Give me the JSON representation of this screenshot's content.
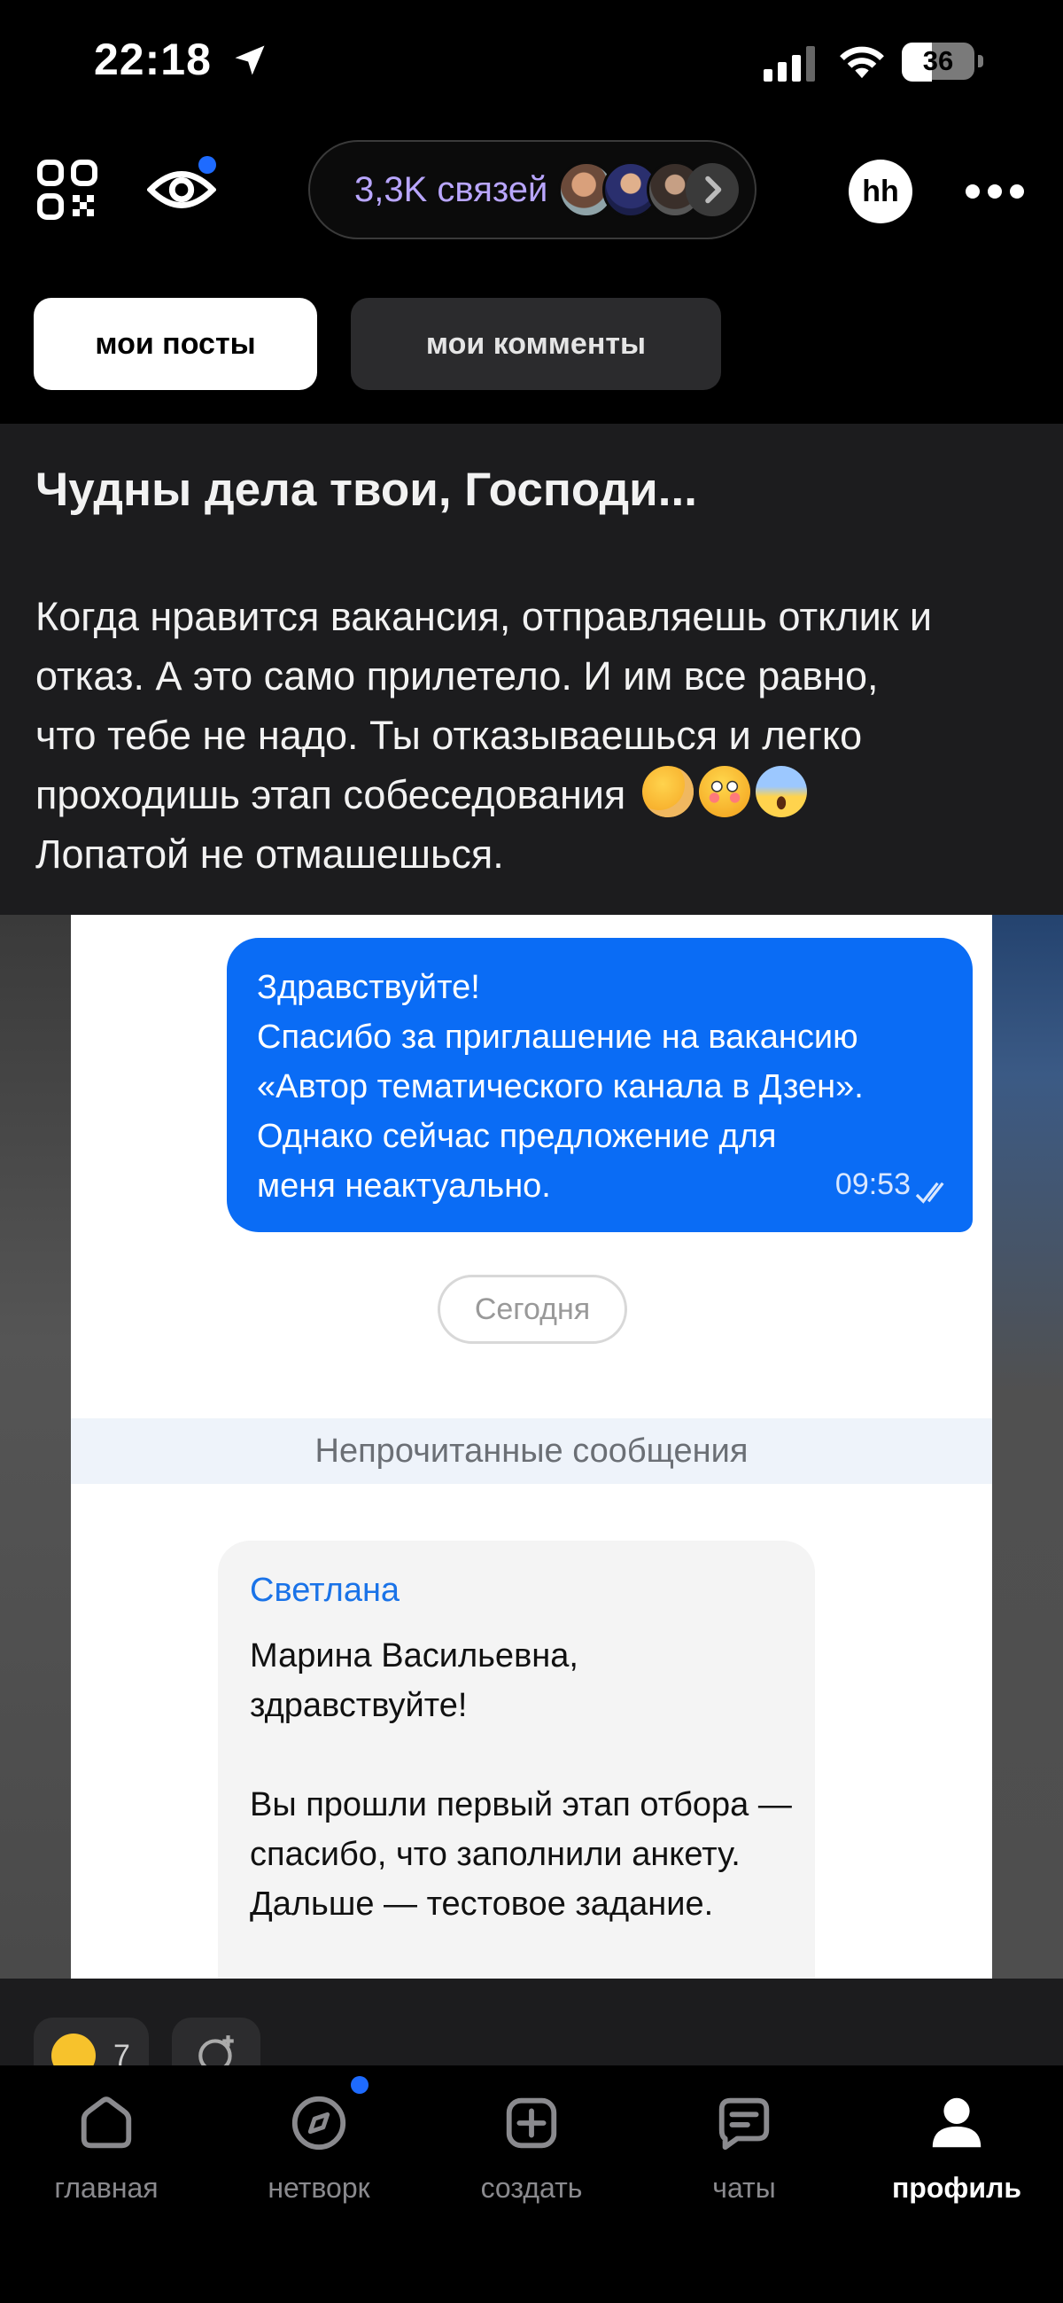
{
  "status_bar": {
    "time": "22:18",
    "battery": "36"
  },
  "top_bar": {
    "connections_label": "3,3K связей",
    "profile_badge": "hh"
  },
  "tabs": [
    {
      "label": "мои посты",
      "active": true
    },
    {
      "label": "мои комменты",
      "active": false
    }
  ],
  "post": {
    "title": "Чудны дела твои, Господи...",
    "body_lines": [
      "Когда нравится вакансия, отправляешь отклик и",
      "отказ. А это само прилетело. И им все равно,",
      "что тебе не надо. Ты отказываешься и легко",
      "проходишь этап собеседования",
      "Лопатой не отмашешься."
    ],
    "emojis": [
      "face-with-hand-over-mouth",
      "flushed-face",
      "screaming-face"
    ]
  },
  "chat_screenshot": {
    "outgoing": {
      "lines": [
        "Здравствуйте!",
        "Спасибо за приглашение на вакансию",
        "«Автор тематического канала в Дзен».",
        "Однако сейчас предложение для",
        "меня неактуально."
      ],
      "time": "09:53"
    },
    "date_pill": "Сегодня",
    "unread_divider": "Непрочитанные сообщения",
    "incoming": {
      "sender": "Светлана",
      "lines_1": [
        "Марина Васильевна,",
        "здравствуйте!"
      ],
      "lines_2": [
        "Вы прошли первый этап отбора —",
        "спасибо, что заполнили анкету.",
        "Дальше — тестовое задание."
      ]
    }
  },
  "reactions": [
    {
      "emoji": "grinning-face",
      "count": "7"
    }
  ],
  "bottom_nav": [
    {
      "label": "главная",
      "icon": "home-icon",
      "active": false
    },
    {
      "label": "нетворк",
      "icon": "compass-icon",
      "active": false,
      "badge": true
    },
    {
      "label": "создать",
      "icon": "plus-square-icon",
      "active": false
    },
    {
      "label": "чаты",
      "icon": "chat-icon",
      "active": false
    },
    {
      "label": "профиль",
      "icon": "profile-icon",
      "active": true
    }
  ],
  "colors": {
    "accent_blue": "#0a6cf5",
    "badge_blue": "#1e6bff",
    "connections_text": "#b9a6ff",
    "sender_blue": "#1a73e8"
  }
}
